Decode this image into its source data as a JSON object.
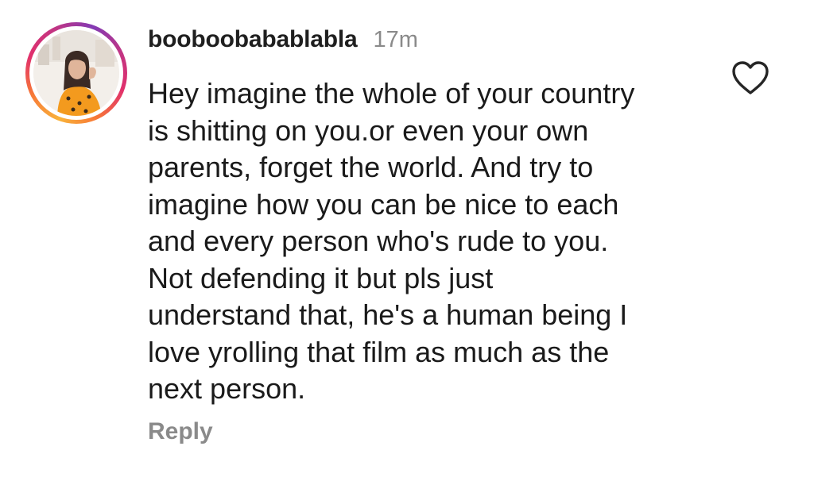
{
  "comment": {
    "username": "booboobabablabla",
    "timestamp": "17m",
    "text": "Hey imagine the whole of your country\nis shitting on you.or even your own\nparents, forget the world. And try to\nimagine how you can be nice to each\nand every person who's rude to you.\nNot defending it but pls just\nunderstand that, he's a human being I\nlove yrolling that film as much as the\nnext person.",
    "reply_label": "Reply",
    "like_icon": "heart-outline-icon"
  },
  "colors": {
    "text": "#1a1a1a",
    "muted": "#8a8a8a",
    "ring_gradient": [
      "#f9b33a",
      "#f77737",
      "#e1306c",
      "#c13584",
      "#833ab4"
    ]
  }
}
